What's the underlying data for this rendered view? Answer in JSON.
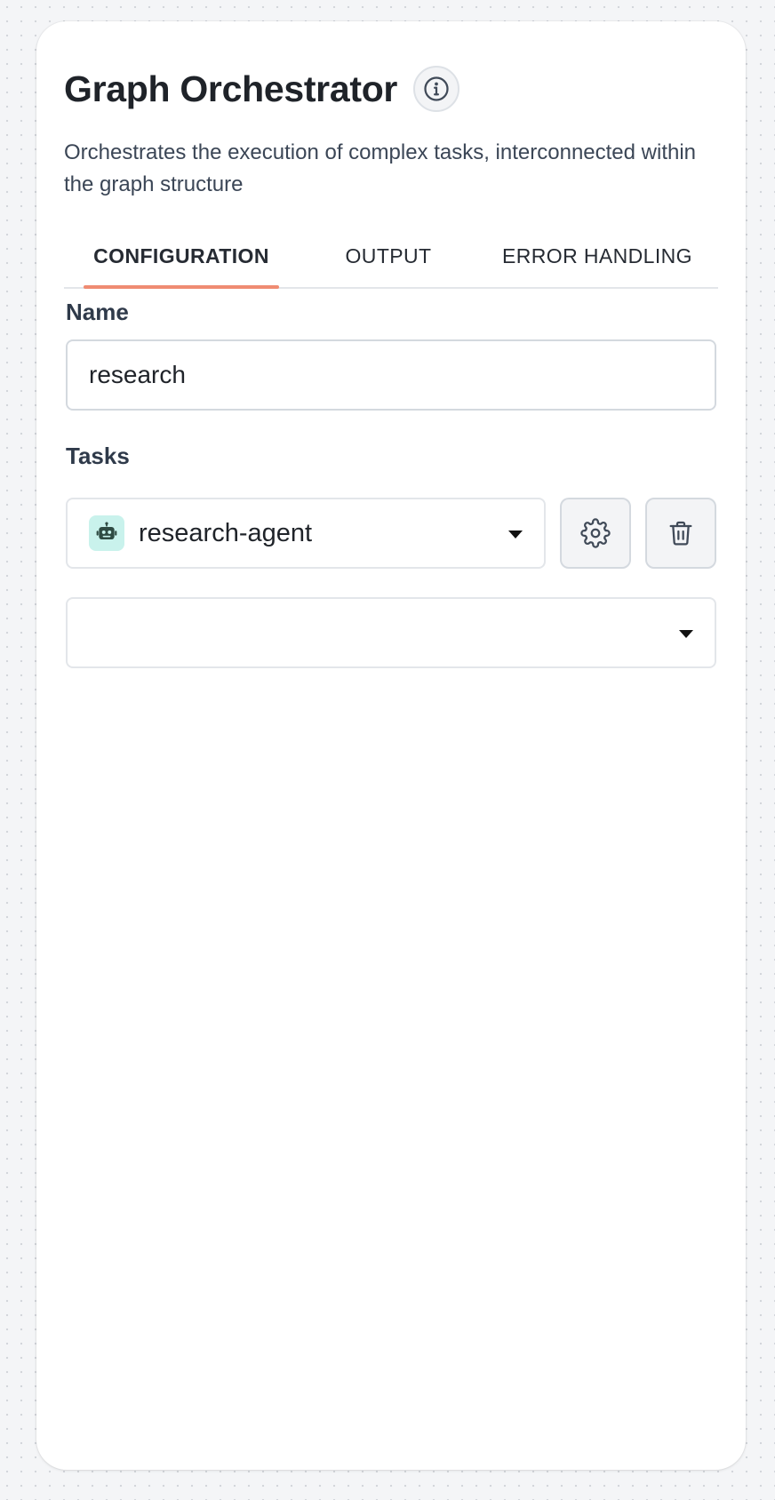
{
  "header": {
    "title": "Graph Orchestrator",
    "info_icon": "info-circle-icon",
    "description": "Orchestrates the execution of complex tasks, interconnected within the graph structure"
  },
  "tabs": [
    {
      "label": "CONFIGURATION",
      "active": true
    },
    {
      "label": "OUTPUT",
      "active": false
    },
    {
      "label": "ERROR HANDLING",
      "active": false
    }
  ],
  "form": {
    "name_label": "Name",
    "name_value": "research",
    "tasks_label": "Tasks",
    "tasks": [
      {
        "value": "research-agent",
        "icon": "robot-icon"
      }
    ],
    "new_task_value": "",
    "settings_icon": "gear-icon",
    "delete_icon": "trash-icon"
  },
  "colors": {
    "accent": "#ef8b72",
    "agent_icon_bg": "#c9f2ec"
  }
}
